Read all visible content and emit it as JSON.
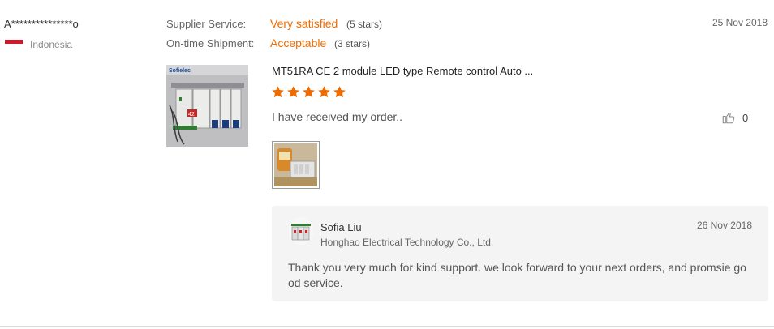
{
  "buyer": {
    "name": "A***************o",
    "country": "Indonesia",
    "flag_colors": [
      "#cc1b2a",
      "#ffffff"
    ]
  },
  "ratings": {
    "supplier_service": {
      "label": "Supplier Service:",
      "value": "Very satisfied",
      "stars_text": "(5 stars)"
    },
    "on_time_shipment": {
      "label": "On-time Shipment:",
      "value": "Acceptable",
      "stars_text": "(3 stars)"
    },
    "accent_color": "#f06c00"
  },
  "review": {
    "date": "25 Nov 2018",
    "product_title": "MT51RA CE 2 module LED type Remote control Auto ...",
    "product_stars": 5,
    "text": "I have received my order..",
    "like_count": "0",
    "thumb_brand": "Sofielec",
    "thumb_panel_text": "42"
  },
  "reply": {
    "name": "Sofia Liu",
    "company": "Honghao Electrical Technology Co., Ltd.",
    "date": "26 Nov 2018",
    "text": "Thank you very much for kind support. we look forward to your next orders, and promsie go od service."
  },
  "icons": {
    "like": "thumbs-up-icon",
    "star": "star-icon"
  }
}
